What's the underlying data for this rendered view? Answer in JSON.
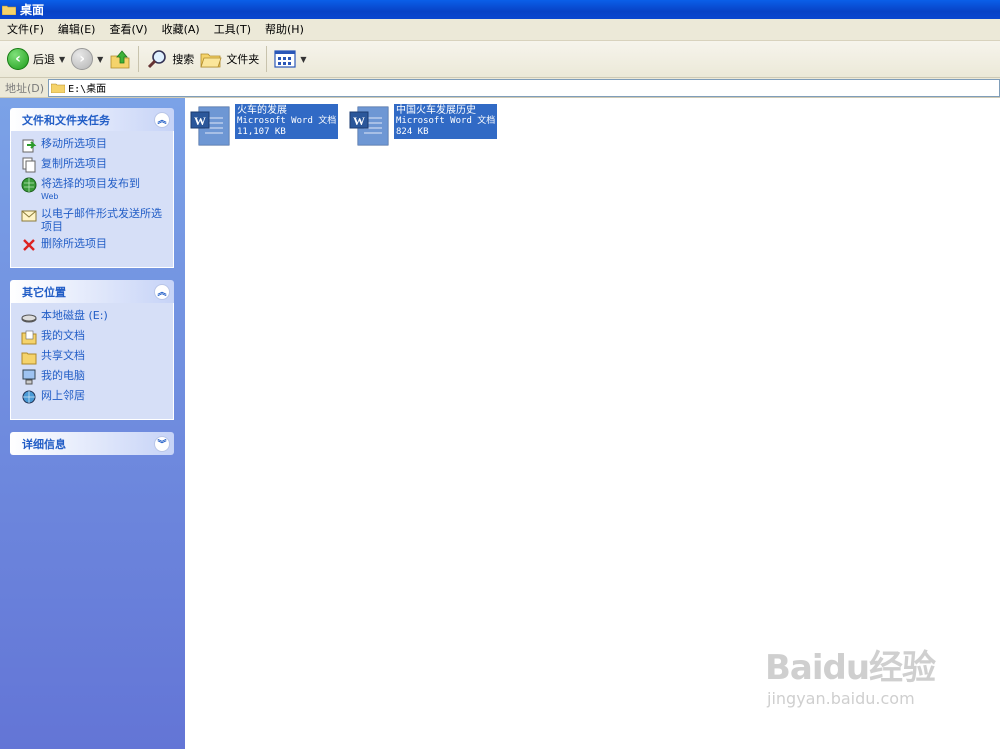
{
  "window": {
    "title": "桌面"
  },
  "menu": [
    {
      "label": "文件(F)"
    },
    {
      "label": "编辑(E)"
    },
    {
      "label": "查看(V)"
    },
    {
      "label": "收藏(A)"
    },
    {
      "label": "工具(T)"
    },
    {
      "label": "帮助(H)"
    }
  ],
  "toolbar": {
    "back_label": "后退",
    "search_label": "搜索",
    "folders_label": "文件夹"
  },
  "address": {
    "label": "地址(D)",
    "value": "E:\\桌面"
  },
  "panels": {
    "tasks": {
      "title": "文件和文件夹任务",
      "items": [
        {
          "label": "移动所选项目"
        },
        {
          "label": "复制所选项目"
        },
        {
          "label": "将选择的项目发布到",
          "sub": "Web"
        },
        {
          "label": "以电子邮件形式发送所选项目"
        },
        {
          "label": "删除所选项目"
        }
      ]
    },
    "places": {
      "title": "其它位置",
      "items": [
        {
          "label": "本地磁盘 (E:)"
        },
        {
          "label": "我的文档"
        },
        {
          "label": "共享文档"
        },
        {
          "label": "我的电脑"
        },
        {
          "label": "网上邻居"
        }
      ]
    },
    "details": {
      "title": "详细信息"
    }
  },
  "files": [
    {
      "name": "火车的发展",
      "type": "Microsoft Word 文档",
      "size": "11,107 KB"
    },
    {
      "name": "中国火车发展历史",
      "type": "Microsoft Word 文档",
      "size": "824 KB"
    }
  ],
  "watermark": {
    "main": "Baidu经验",
    "sub": "jingyan.baidu.com"
  }
}
